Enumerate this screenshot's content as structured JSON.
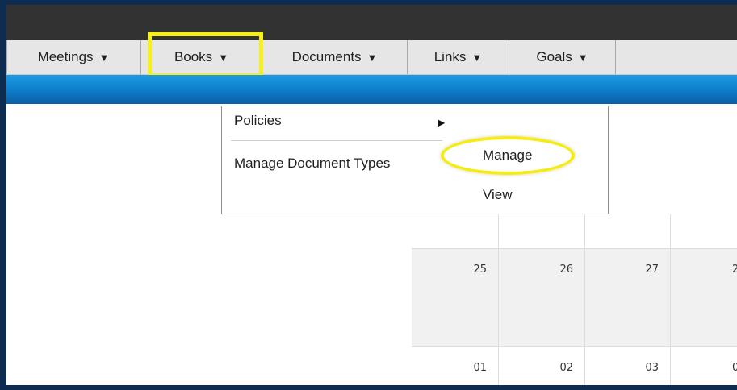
{
  "nav": {
    "items": [
      {
        "label": "Meetings",
        "caret": "▼"
      },
      {
        "label": "Books",
        "caret": "▼"
      },
      {
        "label": "Documents",
        "caret": "▼"
      },
      {
        "label": "Links",
        "caret": "▼"
      },
      {
        "label": "Goals",
        "caret": "▼"
      }
    ],
    "highlighted_item": "Books",
    "highlight_color": "#f6ef19"
  },
  "dropdown": {
    "policies_label": "Policies",
    "submenu_arrow": "▶",
    "manage_types_label": "Manage Document Types",
    "submenu": {
      "manage_label": "Manage",
      "view_label": "View"
    },
    "highlighted_item": "Manage",
    "highlight_color": "#f3ec17"
  },
  "calendar": {
    "row1": [
      "25",
      "26",
      "27",
      "2"
    ],
    "row2": [
      "01",
      "02",
      "03",
      "0"
    ]
  },
  "colors": {
    "top_bar": "#323232",
    "nav_bar": "#e6e6e6",
    "blue_bar": "#0f82cf",
    "calendar_grey": "#f1f1f1"
  }
}
